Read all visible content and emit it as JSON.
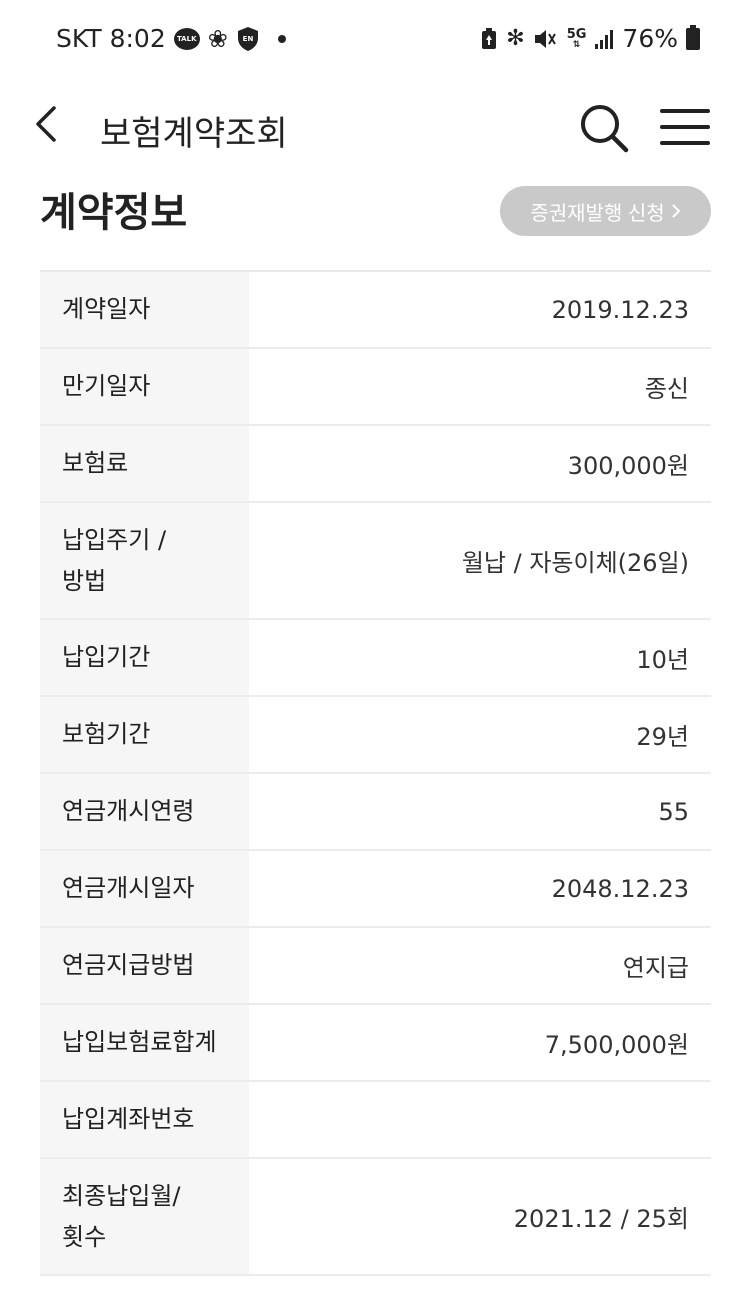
{
  "status_bar": {
    "carrier": "SKT",
    "time": "8:02",
    "talk_badge": "TALK",
    "en_badge": "EN",
    "network": "5G",
    "battery": "76%"
  },
  "header": {
    "title": "보험계약조회"
  },
  "section": {
    "title": "계약정보",
    "reissue_label": "증권재발행 신청"
  },
  "table": {
    "rows": [
      {
        "label": "계약일자",
        "value": "2019.12.23"
      },
      {
        "label": "만기일자",
        "value": "종신"
      },
      {
        "label": "보험료",
        "value": "300,000원"
      },
      {
        "label": "납입주기 /\n방법",
        "value": "월납 / 자동이체(26일)"
      },
      {
        "label": "납입기간",
        "value": "10년"
      },
      {
        "label": "보험기간",
        "value": "29년"
      },
      {
        "label": "연금개시연령",
        "value": "55"
      },
      {
        "label": "연금개시일자",
        "value": "2048.12.23"
      },
      {
        "label": "연금지급방법",
        "value": "연지급"
      },
      {
        "label": "납입보험료합계",
        "value": "7,500,000원"
      },
      {
        "label": "납입계좌번호",
        "value": ""
      },
      {
        "label": "최종납입월/\n횟수",
        "value": "2021.12 / 25회"
      }
    ]
  }
}
